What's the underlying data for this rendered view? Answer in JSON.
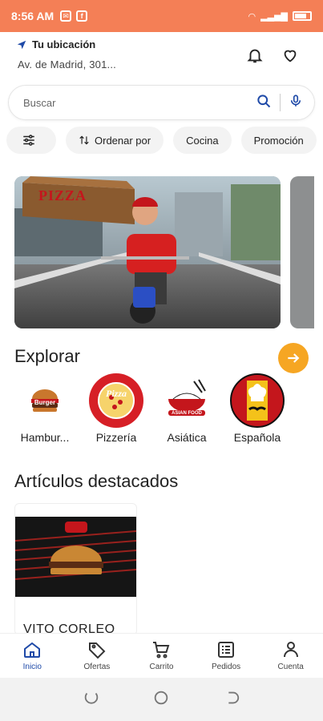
{
  "status_bar": {
    "time": "8:56 AM"
  },
  "header": {
    "location_label": "Tu ubicación",
    "address": "Av. de Madrid, 301..."
  },
  "search": {
    "placeholder": "Buscar"
  },
  "filters": [
    {
      "id": "filters",
      "label": "",
      "icon": "sliders-icon"
    },
    {
      "id": "sort",
      "label": "Ordenar por",
      "icon": "sort-icon"
    },
    {
      "id": "cuisine",
      "label": "Cocina"
    },
    {
      "id": "promo",
      "label": "Promoción"
    }
  ],
  "banner": {
    "brand_text": "PIZZA"
  },
  "explore": {
    "title": "Explorar",
    "categories": [
      {
        "label": "Hambur...",
        "logo_text": "Burger"
      },
      {
        "label": "Pizzería",
        "logo_text": "Pizza"
      },
      {
        "label": "Asiática",
        "logo_text": "ASIAN FOOD"
      },
      {
        "label": "Española",
        "logo_text": ""
      }
    ]
  },
  "featured": {
    "title": "Artículos destacados",
    "items": [
      {
        "name": "VITO CORLEO"
      }
    ]
  },
  "bottom_nav": [
    {
      "label": "Inicio",
      "icon": "home-icon",
      "active": true
    },
    {
      "label": "Ofertas",
      "icon": "tag-icon",
      "active": false
    },
    {
      "label": "Carrito",
      "icon": "cart-icon",
      "active": false
    },
    {
      "label": "Pedidos",
      "icon": "orders-icon",
      "active": false
    },
    {
      "label": "Cuenta",
      "icon": "user-icon",
      "active": false
    }
  ],
  "colors": {
    "status_bar": "#f47f56",
    "accent": "#f6a623",
    "active_nav": "#1f4aa8"
  }
}
